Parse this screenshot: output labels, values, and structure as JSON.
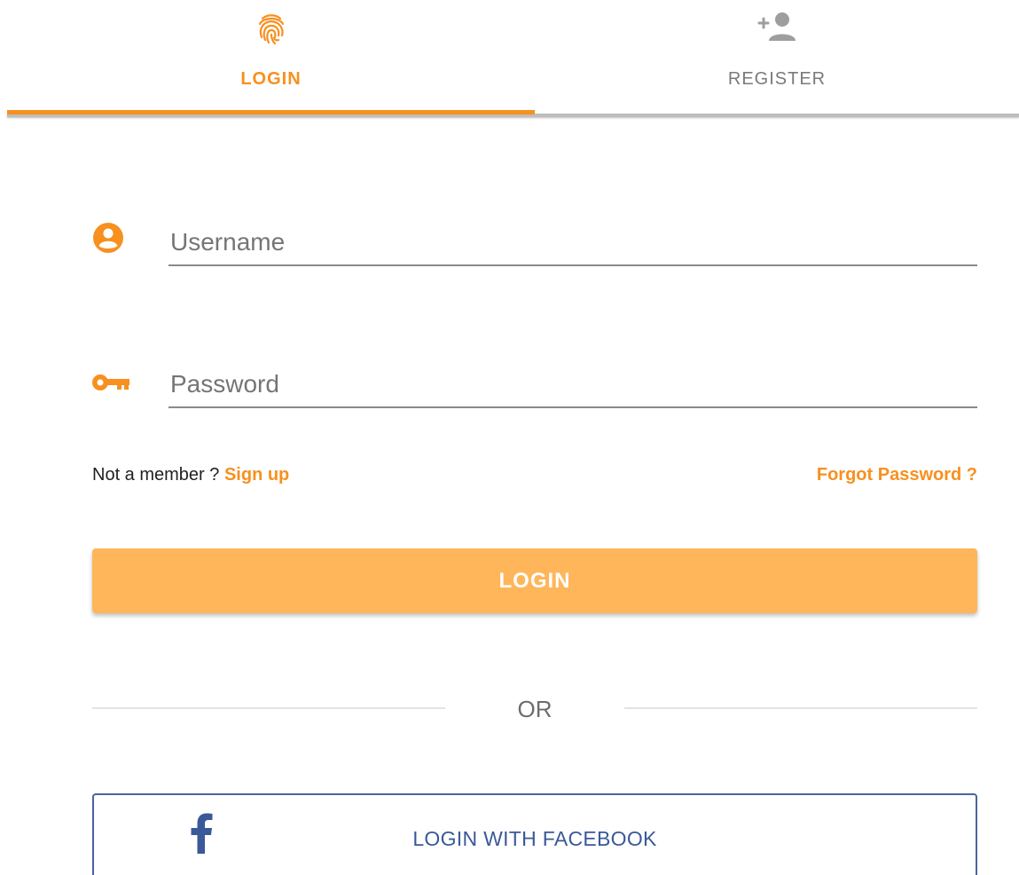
{
  "tabs": [
    {
      "label": "LOGIN",
      "icon": "fingerprint-icon",
      "active": true
    },
    {
      "label": "REGISTER",
      "icon": "person-add-icon",
      "active": false
    }
  ],
  "form": {
    "username_placeholder": "Username",
    "username_value": "",
    "password_placeholder": "Password",
    "password_value": ""
  },
  "links": {
    "not_member": "Not a member ?",
    "sign_up": "Sign up",
    "forgot_password": "Forgot Password ?"
  },
  "login_button": "LOGIN",
  "divider_text": "OR",
  "facebook_button": "LOGIN WITH FACEBOOK",
  "colors": {
    "accent": "#f7901e",
    "button": "#ffb65a",
    "facebook": "#3b5998"
  }
}
